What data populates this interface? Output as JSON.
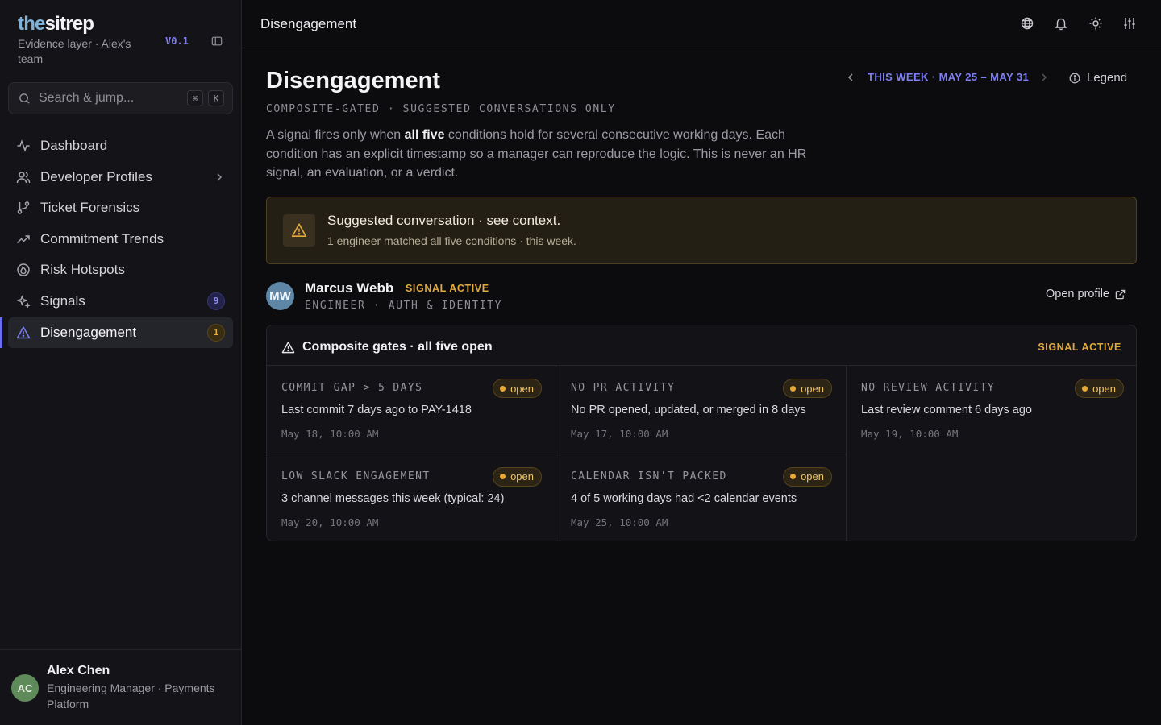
{
  "app": {
    "logo_the": "the",
    "logo_sitrep": "sitrep",
    "subtitle": "Evidence layer · Alex's team",
    "version": "V0.1"
  },
  "search": {
    "placeholder": "Search & jump...",
    "kbd_cmd": "⌘",
    "kbd_key": "K"
  },
  "nav": [
    {
      "label": "Dashboard",
      "icon": "activity-icon"
    },
    {
      "label": "Developer Profiles",
      "icon": "users-icon"
    },
    {
      "label": "Ticket Forensics",
      "icon": "git-branch-icon"
    },
    {
      "label": "Commitment Trends",
      "icon": "trending-up-icon"
    },
    {
      "label": "Risk Hotspots",
      "icon": "flame-icon"
    },
    {
      "label": "Signals",
      "icon": "sparkle-icon",
      "count": "9"
    },
    {
      "label": "Disengagement",
      "icon": "warning-icon",
      "count": "1",
      "active": true
    }
  ],
  "user": {
    "initials": "AC",
    "name": "Alex Chen",
    "role": "Engineering Manager · Payments Platform"
  },
  "topbar": {
    "title": "Disengagement"
  },
  "page": {
    "title": "Disengagement",
    "kicker": "COMPOSITE-GATED · SUGGESTED CONVERSATIONS ONLY",
    "desc_before": "A signal fires only when ",
    "desc_bold": "all five",
    "desc_after": " conditions hold for several consecutive working days. Each condition has an explicit timestamp so a manager can reproduce the logic. This is never an HR signal, an evaluation, or a verdict.",
    "week_label": "THIS WEEK · MAY 25 – MAY 31",
    "legend_label": "Legend"
  },
  "banner": {
    "title": "Suggested conversation · see context.",
    "subtitle": "1 engineer matched all five conditions · this week."
  },
  "person": {
    "initials": "MW",
    "name": "Marcus Webb",
    "signal": "SIGNAL ACTIVE",
    "role": "ENGINEER · AUTH & IDENTITY",
    "open_profile": "Open profile"
  },
  "gates": {
    "title": "Composite gates · all five open",
    "status": "SIGNAL ACTIVE",
    "items": [
      {
        "name": "COMMIT GAP > 5 DAYS",
        "state": "open",
        "desc": "Last commit 7 days ago to PAY-1418",
        "ts": "May 18, 10:00 AM"
      },
      {
        "name": "NO PR ACTIVITY",
        "state": "open",
        "desc": "No PR opened, updated, or merged in 8 days",
        "ts": "May 17, 10:00 AM"
      },
      {
        "name": "NO REVIEW ACTIVITY",
        "state": "open",
        "desc": "Last review comment 6 days ago",
        "ts": "May 19, 10:00 AM"
      },
      {
        "name": "LOW SLACK ENGAGEMENT",
        "state": "open",
        "desc": "3 channel messages this week (typical: 24)",
        "ts": "May 20, 10:00 AM"
      },
      {
        "name": "CALENDAR ISN'T PACKED",
        "state": "open",
        "desc": "4 of 5 working days had <2 calendar events",
        "ts": "May 25, 10:00 AM"
      }
    ]
  },
  "colors": {
    "accent": "#6d6df0",
    "amber": "#e2a93c",
    "background": "#0c0c0f"
  }
}
